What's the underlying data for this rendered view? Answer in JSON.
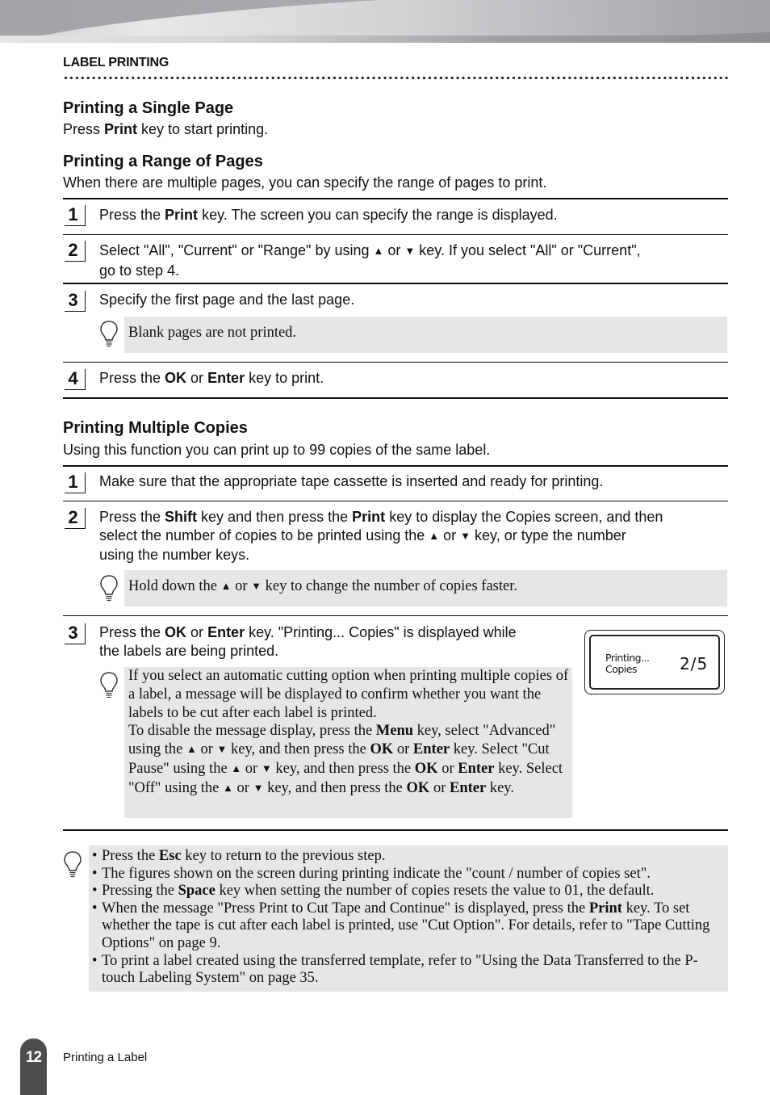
{
  "header": {
    "section": "LABEL PRINTING"
  },
  "single_page": {
    "title": "Printing a Single Page",
    "text_pre": "Press ",
    "text_bold": "Print",
    "text_post": " key to start printing."
  },
  "range": {
    "title": "Printing a Range of Pages",
    "intro": "When there are multiple pages, you can specify the range of pages to print.",
    "steps": [
      {
        "num": "1",
        "pre": "Press the ",
        "bold": "Print",
        "post": " key. The screen you can specify the range is displayed."
      },
      {
        "num": "2",
        "line1_pre": "Select  \"All\", \"Current\" or \"Range\" by using ",
        "or": " or ",
        "line1_post": " key. If you select \"All\" or \"Current\",",
        "line2": "go to step 4."
      },
      {
        "num": "3",
        "text": "Specify the first page and the last page.",
        "note": "Blank pages are not printed."
      },
      {
        "num": "4",
        "pre": "Press the ",
        "bold1": "OK",
        "mid": " or ",
        "bold2": "Enter",
        "post": " key to print."
      }
    ]
  },
  "copies": {
    "title": "Printing Multiple Copies",
    "intro": "Using this function you can print up to 99 copies of the same label.",
    "steps": [
      {
        "num": "1",
        "text": "Make sure that the appropriate tape cassette is inserted and ready for printing."
      },
      {
        "num": "2",
        "l1_a": "Press the ",
        "l1_b": "Shift",
        "l1_c": " key and then press the ",
        "l1_d": "Print",
        "l1_e": " key to display the Copies screen, and then",
        "l2_a": "select the number of copies to be printed using the ",
        "l2_or": " or ",
        "l2_b": " key, or type the number",
        "l3": "using the number keys.",
        "note_a": "Hold down the ",
        "note_or": " or ",
        "note_b": " key to change the number of copies faster."
      },
      {
        "num": "3",
        "l1_a": "Press the ",
        "l1_b": "OK",
        "l1_c": " or ",
        "l1_d": "Enter",
        "l1_e": " key. \"Printing... Copies\" is displayed while",
        "l2": "the labels are being printed.",
        "note": {
          "p1": "If you select an automatic cutting option when printing multiple copies of a label, a message will be displayed to confirm whether you want the labels to be cut after each label is printed.",
          "p2_a": "To disable the message display, press the ",
          "p2_menu": "Menu",
          "p2_b": " key, select \"Advanced\" using the ",
          "p2_or": " or ",
          "p2_c": " key, and then press the ",
          "p2_ok": "OK",
          "p2_orw": " or ",
          "p2_enter": "Enter",
          "p2_d": " key. Select \"Cut Pause\" using the ",
          "p2_or2": " or ",
          "p2_e": " key, and then press the ",
          "p2_ok2": "OK",
          "p2_orw2": " or ",
          "p2_enter2": "Enter",
          "p2_f": " key. Select \"Off\" using the ",
          "p2_or3": " or ",
          "p2_g": " key, and then press the ",
          "p2_ok3": "OK",
          "p2_orw3": " or ",
          "p2_enter3": "Enter",
          "p2_h": " key."
        }
      }
    ],
    "lcd": {
      "line1": "Printing...",
      "line2": "Copies",
      "count": "2/5"
    }
  },
  "tips": [
    {
      "a": "Press the ",
      "b": "Esc",
      "c": " key to return to the previous step."
    },
    {
      "a": "The figures shown on the screen during printing indicate the \"count / number of copies set\"."
    },
    {
      "a": "Pressing the ",
      "b": "Space",
      "c": " key when setting the number of copies resets the value to 01, the default."
    },
    {
      "a": "When the message \"Press Print to Cut Tape and Continue\" is displayed, press the ",
      "b": "Print",
      "c": " key. To set whether the tape is cut after each label is printed, use \"Cut Option\". For details, refer to \"Tape Cutting Options\" on page 9."
    },
    {
      "a": "To print a label created using the transferred template, refer to \"Using the Data Transferred to the P-touch Labeling System\" on page 35."
    }
  ],
  "symbols": {
    "up": "▲",
    "down": "▼"
  },
  "footer": {
    "page_number": "12",
    "chapter": "Printing a Label"
  }
}
